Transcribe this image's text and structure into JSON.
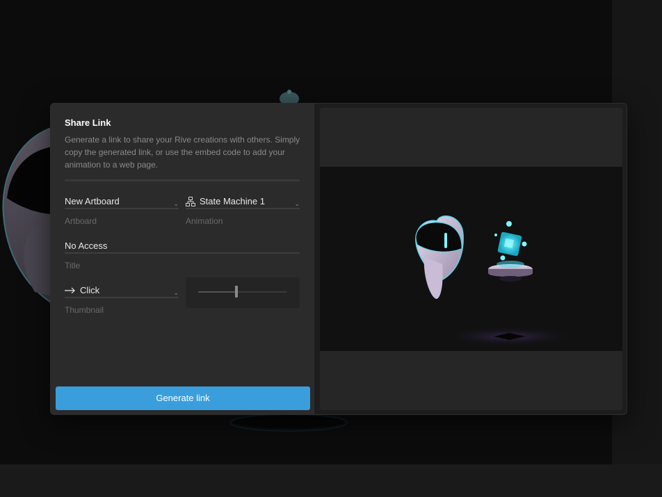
{
  "modal": {
    "title": "Share Link",
    "description": "Generate a link to share your Rive creations with others. Simply copy the generated link, or use the embed code to add your animation to a web page.",
    "artboard": {
      "value": "New Artboard",
      "label": "Artboard"
    },
    "animation": {
      "value": "State Machine 1",
      "label": "Animation",
      "icon": "state-machine-icon"
    },
    "title_field": {
      "value": "No Access",
      "label": "Title"
    },
    "thumbnail": {
      "value": "Click",
      "label": "Thumbnail",
      "icon": "arrow-right-icon"
    },
    "thumbnail_slider": {
      "value": 0.43
    },
    "generate_label": "Generate link"
  },
  "colors": {
    "accent": "#3a9edd",
    "panel": "#2b2b2b",
    "background": "#0c0c0c"
  }
}
